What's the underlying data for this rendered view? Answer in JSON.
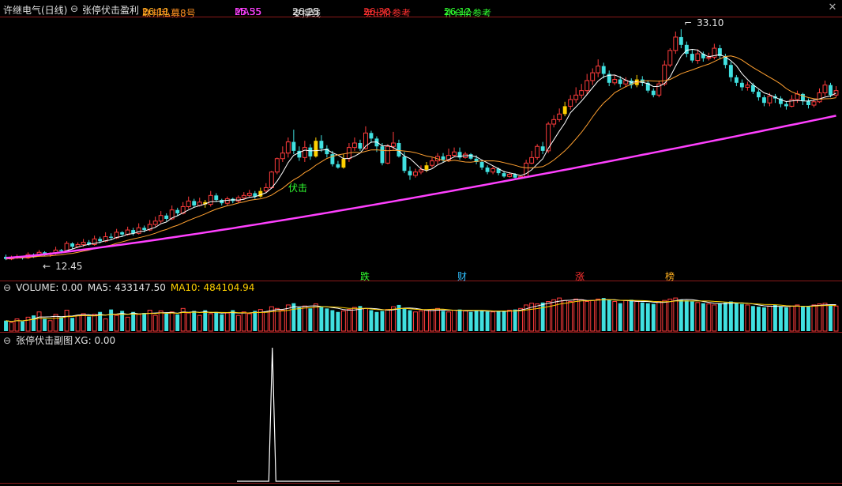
{
  "header": {
    "stock_name": "许继电气(日线)",
    "indicator_name": "张停伏击盈利",
    "items": [
      {
        "label": "联邦私募8号",
        "value": "26.11",
        "color": "#ffb020",
        "label_color": "#ff9020"
      },
      {
        "label": "MA55",
        "value": "25.35",
        "color": "#ff40ff",
        "label_color": "#ff40ff"
      },
      {
        "label": "支撑线",
        "value": "26.25",
        "color": "#e0e0e0",
        "label_color": "#e0e0e0"
      },
      {
        "label": "卖出价参考",
        "value": "26.30",
        "color": "#ff3030",
        "label_color": "#ff3030"
      },
      {
        "label": "补仓价参考",
        "value": "26.12",
        "color": "#30ff30",
        "label_color": "#30ff30"
      }
    ],
    "close_icon": "close-icon"
  },
  "main_panel": {
    "high_label": "33.10",
    "low_label": "12.45",
    "signal_label": "伏击",
    "bottom_markers": [
      {
        "text": "跌",
        "color": "#30ff30"
      },
      {
        "text": "财",
        "color": "#30c0ff"
      },
      {
        "text": "涨",
        "color": "#ff3030"
      },
      {
        "text": "榜",
        "color": "#ffb020"
      }
    ]
  },
  "volume_panel": {
    "title": "VOLUME: 0.00",
    "ma5": "MA5: 433147.50",
    "ma10": "MA10: 484104.94"
  },
  "sub_panel": {
    "title": "张停伏击副图",
    "xg": "XG: 0.00"
  },
  "colors": {
    "up": "#ff3c3c",
    "down": "#40e0e0",
    "signal": "#ffd000",
    "ma55": "#ff40ff",
    "ma_short": "#ffffff",
    "ma_mid": "#ffa030",
    "vol_ma5": "#ffffff",
    "vol_ma10": "#ffd000"
  },
  "chart_data": [
    {
      "type": "candlestick",
      "title": "",
      "ylim": [
        12.2,
        33.6
      ],
      "labels": {
        "max": 33.1,
        "min": 12.45
      },
      "candles": [
        [
          12.7,
          12.5,
          12.9,
          12.4
        ],
        [
          12.5,
          12.6,
          12.8,
          12.4
        ],
        [
          12.6,
          12.7,
          12.9,
          12.5
        ],
        [
          12.7,
          12.6,
          12.8,
          12.45
        ],
        [
          12.6,
          12.9,
          13.1,
          12.5
        ],
        [
          12.9,
          12.8,
          13.0,
          12.6
        ],
        [
          12.8,
          13.1,
          13.3,
          12.7
        ],
        [
          13.1,
          12.9,
          13.2,
          12.8
        ],
        [
          12.9,
          13.0,
          13.1,
          12.7
        ],
        [
          13.0,
          13.3,
          13.6,
          12.9
        ],
        [
          13.3,
          13.2,
          13.4,
          13.0
        ],
        [
          13.2,
          13.9,
          14.1,
          13.1
        ],
        [
          13.9,
          13.6,
          14.0,
          13.4
        ],
        [
          13.6,
          13.8,
          14.0,
          13.5
        ],
        [
          13.8,
          14.0,
          14.3,
          13.6
        ],
        [
          14.0,
          13.8,
          14.2,
          13.7
        ],
        [
          13.8,
          14.3,
          14.6,
          13.7
        ],
        [
          14.3,
          14.1,
          14.5,
          13.9
        ],
        [
          14.1,
          14.5,
          14.9,
          14.0
        ],
        [
          14.5,
          14.4,
          14.8,
          14.2
        ],
        [
          14.4,
          14.9,
          15.2,
          14.3
        ],
        [
          14.9,
          14.7,
          15.0,
          14.5
        ],
        [
          14.7,
          15.1,
          15.4,
          14.6
        ],
        [
          15.1,
          14.8,
          15.3,
          14.6
        ],
        [
          14.8,
          15.3,
          15.7,
          14.7
        ],
        [
          15.3,
          15.1,
          15.5,
          14.9
        ],
        [
          15.1,
          15.6,
          16.0,
          15.0
        ],
        [
          15.6,
          15.9,
          16.3,
          15.4
        ],
        [
          15.9,
          16.4,
          16.8,
          15.7
        ],
        [
          16.4,
          16.1,
          16.6,
          15.9
        ],
        [
          16.1,
          16.9,
          17.3,
          16.0
        ],
        [
          16.9,
          16.6,
          17.1,
          16.4
        ],
        [
          16.6,
          17.2,
          17.6,
          16.5
        ],
        [
          17.2,
          17.7,
          18.1,
          17.0
        ],
        [
          17.7,
          17.3,
          17.9,
          17.1
        ],
        [
          17.3,
          17.6,
          18.0,
          17.2
        ],
        [
          17.6,
          17.4,
          17.8,
          17.1
        ],
        [
          17.4,
          18.2,
          18.6,
          17.2
        ],
        [
          18.2,
          17.8,
          18.4,
          17.6
        ],
        [
          17.8,
          17.5,
          17.9,
          17.3
        ],
        [
          17.5,
          17.9,
          18.1,
          17.3
        ],
        [
          17.9,
          17.7,
          18.0,
          17.5
        ],
        [
          17.7,
          18.0,
          18.2,
          17.5
        ],
        [
          18.0,
          18.2,
          18.5,
          17.8
        ],
        [
          18.2,
          18.4,
          18.7,
          18.0
        ],
        [
          18.4,
          18.1,
          18.6,
          17.9
        ],
        [
          18.1,
          18.6,
          18.9,
          18.0
        ],
        [
          18.6,
          18.9,
          19.3,
          18.4
        ],
        [
          18.9,
          20.3,
          20.4,
          18.8
        ],
        [
          20.3,
          21.5,
          21.6,
          20.1
        ],
        [
          21.5,
          22.0,
          22.6,
          21.2
        ],
        [
          22.0,
          23.0,
          23.4,
          21.6
        ],
        [
          23.0,
          22.2,
          24.1,
          21.9
        ],
        [
          22.2,
          21.6,
          22.6,
          21.3
        ],
        [
          21.6,
          22.5,
          23.1,
          21.2
        ],
        [
          22.5,
          21.7,
          22.8,
          21.4
        ],
        [
          21.7,
          23.1,
          23.4,
          21.6
        ],
        [
          23.1,
          22.4,
          23.6,
          22.1
        ],
        [
          22.4,
          21.9,
          22.7,
          21.6
        ],
        [
          21.9,
          21.0,
          22.2,
          20.8
        ],
        [
          21.0,
          20.7,
          21.3,
          20.6
        ],
        [
          20.7,
          21.5,
          21.9,
          20.6
        ],
        [
          21.5,
          22.5,
          22.9,
          21.2
        ],
        [
          22.5,
          22.9,
          23.4,
          22.2
        ],
        [
          22.9,
          22.4,
          23.2,
          22.2
        ],
        [
          22.4,
          23.8,
          24.4,
          22.3
        ],
        [
          23.8,
          23.3,
          24.0,
          22.9
        ],
        [
          23.3,
          22.6,
          23.5,
          22.1
        ],
        [
          22.6,
          21.1,
          22.9,
          20.9
        ],
        [
          21.1,
          22.6,
          22.8,
          21.0
        ],
        [
          22.6,
          22.9,
          23.9,
          22.3
        ],
        [
          22.9,
          21.7,
          23.2,
          21.6
        ],
        [
          21.7,
          20.4,
          22.1,
          20.2
        ],
        [
          20.4,
          20.0,
          20.8,
          19.6
        ],
        [
          20.0,
          20.3,
          20.6,
          19.8
        ],
        [
          20.3,
          20.5,
          20.9,
          20.1
        ],
        [
          20.5,
          20.9,
          21.2,
          20.3
        ],
        [
          20.9,
          21.3,
          21.6,
          20.7
        ],
        [
          21.3,
          21.7,
          22.0,
          21.0
        ],
        [
          21.7,
          21.4,
          22.0,
          21.2
        ],
        [
          21.4,
          21.8,
          22.4,
          21.2
        ],
        [
          21.8,
          22.1,
          22.5,
          21.7
        ],
        [
          22.1,
          21.6,
          22.5,
          21.4
        ],
        [
          21.6,
          21.9,
          22.1,
          21.5
        ],
        [
          21.9,
          21.5,
          22.0,
          21.4
        ],
        [
          21.5,
          21.2,
          21.8,
          21.0
        ],
        [
          21.2,
          20.7,
          21.3,
          20.5
        ],
        [
          20.7,
          20.3,
          20.9,
          20.1
        ],
        [
          20.3,
          20.6,
          20.8,
          20.1
        ],
        [
          20.6,
          20.2,
          20.7,
          20.0
        ],
        [
          20.2,
          19.9,
          20.4,
          19.8
        ],
        [
          19.9,
          20.1,
          20.3,
          19.8
        ],
        [
          20.1,
          19.8,
          20.2,
          19.7
        ],
        [
          19.8,
          19.9,
          20.0,
          19.7
        ],
        [
          19.9,
          21.1,
          21.4,
          19.9
        ],
        [
          21.1,
          21.6,
          22.2,
          21.0
        ],
        [
          21.6,
          22.6,
          22.8,
          21.4
        ],
        [
          22.6,
          22.2,
          23.0,
          21.9
        ],
        [
          22.2,
          24.6,
          24.8,
          22.0
        ],
        [
          24.6,
          25.0,
          25.4,
          24.3
        ],
        [
          25.0,
          25.5,
          26.0,
          24.8
        ],
        [
          25.5,
          26.2,
          26.6,
          25.3
        ],
        [
          26.2,
          26.8,
          27.2,
          25.9
        ],
        [
          26.8,
          27.2,
          27.9,
          26.5
        ],
        [
          27.2,
          27.6,
          28.2,
          26.9
        ],
        [
          27.6,
          28.5,
          29.1,
          27.3
        ],
        [
          28.5,
          29.2,
          29.6,
          28.1
        ],
        [
          29.2,
          29.8,
          30.4,
          28.8
        ],
        [
          29.8,
          29.1,
          30.1,
          28.7
        ],
        [
          29.1,
          28.3,
          29.4,
          28.0
        ],
        [
          28.3,
          28.6,
          29.0,
          28.1
        ],
        [
          28.6,
          28.2,
          28.9,
          27.9
        ],
        [
          28.2,
          28.5,
          28.8,
          27.9
        ],
        [
          28.5,
          28.1,
          28.7,
          27.8
        ],
        [
          28.1,
          28.6,
          29.0,
          27.9
        ],
        [
          28.6,
          28.3,
          28.9,
          28.0
        ],
        [
          28.3,
          27.6,
          28.5,
          27.4
        ],
        [
          27.6,
          27.2,
          27.8,
          27.0
        ],
        [
          27.2,
          28.2,
          28.5,
          27.0
        ],
        [
          28.2,
          29.9,
          30.3,
          28.0
        ],
        [
          29.9,
          31.2,
          31.4,
          29.7
        ],
        [
          31.2,
          32.4,
          32.9,
          30.9
        ],
        [
          32.4,
          31.7,
          33.1,
          31.4
        ],
        [
          31.7,
          30.9,
          32.0,
          30.6
        ],
        [
          30.9,
          30.3,
          31.3,
          30.1
        ],
        [
          30.3,
          30.9,
          31.3,
          30.0
        ],
        [
          30.9,
          30.5,
          31.1,
          30.2
        ],
        [
          30.5,
          30.6,
          31.0,
          30.3
        ],
        [
          30.6,
          31.4,
          31.8,
          30.4
        ],
        [
          31.4,
          30.7,
          31.7,
          30.4
        ],
        [
          30.7,
          29.9,
          30.9,
          29.6
        ],
        [
          29.9,
          28.8,
          30.2,
          28.4
        ],
        [
          28.8,
          28.3,
          29.0,
          28.0
        ],
        [
          28.3,
          27.9,
          28.6,
          27.6
        ],
        [
          27.9,
          28.1,
          28.4,
          27.6
        ],
        [
          28.1,
          27.5,
          28.3,
          27.3
        ],
        [
          27.5,
          27.0,
          27.7,
          26.7
        ],
        [
          27.0,
          26.5,
          27.2,
          26.2
        ],
        [
          26.5,
          27.1,
          27.4,
          26.2
        ],
        [
          27.1,
          26.9,
          27.3,
          26.5
        ],
        [
          26.9,
          26.4,
          27.1,
          26.1
        ],
        [
          26.4,
          26.2,
          26.6,
          25.9
        ],
        [
          26.2,
          26.8,
          27.2,
          26.1
        ],
        [
          26.8,
          27.3,
          27.6,
          26.5
        ],
        [
          27.3,
          26.7,
          27.4,
          26.3
        ],
        [
          26.7,
          26.3,
          26.9,
          26.0
        ],
        [
          26.3,
          26.6,
          26.9,
          26.1
        ],
        [
          26.6,
          27.4,
          27.8,
          26.5
        ],
        [
          27.4,
          28.1,
          28.5,
          27.1
        ],
        [
          28.1,
          27.2,
          28.3,
          27.0
        ],
        [
          27.2,
          27.6,
          28.0,
          27.0
        ]
      ],
      "signal_candles": [
        36,
        46,
        56,
        61,
        76,
        101,
        114
      ],
      "ma55_endpoints": [
        12.6,
        25.35
      ]
    },
    {
      "type": "bar",
      "title": "VOLUME",
      "values": [
        30,
        25,
        35,
        28,
        40,
        45,
        55,
        35,
        30,
        48,
        40,
        60,
        38,
        45,
        50,
        42,
        48,
        55,
        35,
        62,
        45,
        58,
        40,
        55,
        48,
        52,
        60,
        45,
        58,
        50,
        55,
        48,
        65,
        52,
        58,
        45,
        60,
        50,
        55,
        48,
        52,
        60,
        45,
        55,
        50,
        58,
        62,
        55,
        70,
        65,
        60,
        75,
        80,
        68,
        72,
        65,
        78,
        70,
        65,
        60,
        55,
        58,
        62,
        68,
        72,
        65,
        60,
        55,
        58,
        62,
        70,
        75,
        65,
        60,
        55,
        58,
        60,
        62,
        65,
        58,
        55,
        60,
        62,
        58,
        55,
        60,
        58,
        56,
        55,
        57,
        58,
        60,
        62,
        65,
        75,
        80,
        78,
        82,
        85,
        90,
        95,
        88,
        85,
        92,
        90,
        85,
        88,
        92,
        95,
        90,
        85,
        80,
        88,
        90,
        85,
        82,
        80,
        78,
        85,
        88,
        92,
        95,
        90,
        88,
        85,
        82,
        80,
        78,
        75,
        80,
        82,
        85,
        80,
        78,
        75,
        72,
        70,
        68,
        72,
        75,
        70,
        68,
        72,
        75,
        70,
        72,
        75,
        78,
        80,
        75,
        72,
        70,
        75,
        78
      ],
      "ma5_value": 433147.5,
      "ma10_value": 484104.94
    },
    {
      "type": "line",
      "title": "张停伏击副图",
      "series": [
        {
          "name": "XG",
          "values": [
            0,
            0,
            0,
            0,
            0,
            0,
            0,
            0,
            0,
            0,
            1,
            0,
            0,
            0,
            0,
            0,
            0,
            0,
            0,
            0,
            0,
            0,
            0,
            0,
            0,
            0,
            0,
            0,
            0,
            0
          ]
        }
      ],
      "value": 0.0
    }
  ]
}
